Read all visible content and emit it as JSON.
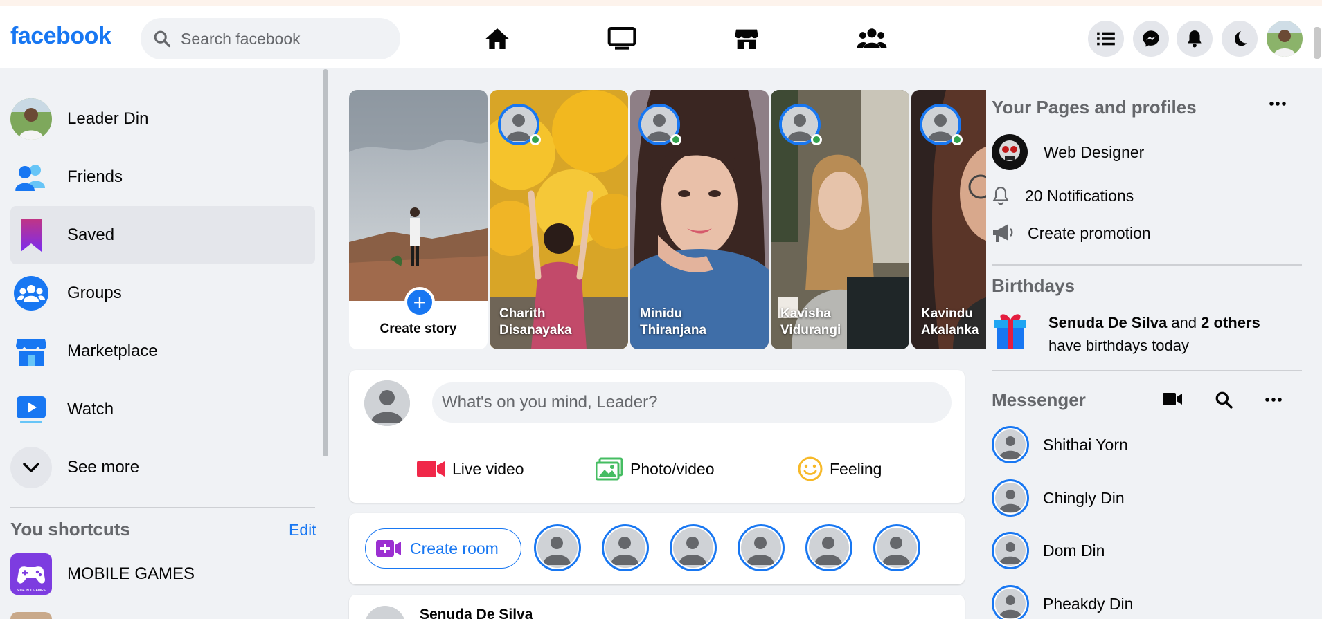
{
  "header": {
    "logo": "facebook",
    "search_placeholder": "Search facebook",
    "nav_icons": [
      "home-icon",
      "watch-tv-icon",
      "marketplace-store-icon",
      "groups-icon"
    ],
    "right_buttons": [
      "menu-list-icon",
      "messenger-icon",
      "bell-icon",
      "dark-mode-moon-icon"
    ]
  },
  "sidebar": {
    "items": [
      {
        "label": "Leader Din",
        "icon": "profile-avatar"
      },
      {
        "label": "Friends",
        "icon": "friends-icon"
      },
      {
        "label": "Saved",
        "icon": "bookmark-icon",
        "active": true
      },
      {
        "label": "Groups",
        "icon": "groups-icon"
      },
      {
        "label": "Marketplace",
        "icon": "marketplace-icon"
      },
      {
        "label": "Watch",
        "icon": "watch-icon"
      },
      {
        "label": "See more",
        "icon": "chevron-down-icon"
      }
    ],
    "shortcuts_title": "You shortcuts",
    "shortcuts_edit": "Edit",
    "shortcuts": [
      {
        "label": "MOBILE GAMES",
        "icon": "gamepad-icon",
        "icon_caption": "500+ IN 1 GAMES"
      }
    ]
  },
  "stories": {
    "create_label": "Create story",
    "items": [
      {
        "name_line1": "Charith",
        "name_line2": "Disanayaka"
      },
      {
        "name_line1": "Minidu",
        "name_line2": "Thiranjana"
      },
      {
        "name_line1": "Kavisha",
        "name_line2": "Vidurangi"
      },
      {
        "name_line1": "Kavindu",
        "name_line2": "Akalanka"
      }
    ]
  },
  "composer": {
    "placeholder": "What's on you mind, Leader?",
    "actions": [
      {
        "label": "Live video",
        "icon": "video-camera-icon",
        "color": "#f02849"
      },
      {
        "label": "Photo/video",
        "icon": "photo-icon",
        "color": "#45bd62"
      },
      {
        "label": "Feeling",
        "icon": "smile-icon",
        "color": "#f7b928"
      }
    ]
  },
  "rooms": {
    "create_label": "Create room",
    "avatar_count": 6
  },
  "post": {
    "author": "Senuda De Silva"
  },
  "rightbar": {
    "pages_title": "Your Pages and profiles",
    "page_name": "Web Designer",
    "notifications": "20 Notifications",
    "create_promotion": "Create promotion",
    "birthdays_title": "Birthdays",
    "birthday_name": "Senuda De Silva",
    "birthday_and": "and",
    "birthday_others": "2 others",
    "birthday_line2": "have birthdays today",
    "messenger_title": "Messenger",
    "contacts": [
      "Shithai Yorn",
      "Chingly Din",
      "Dom Din",
      "Pheakdy Din"
    ]
  },
  "colors": {
    "brand": "#1877f2",
    "active_bg": "#e4e6eb",
    "online": "#31a24c"
  }
}
